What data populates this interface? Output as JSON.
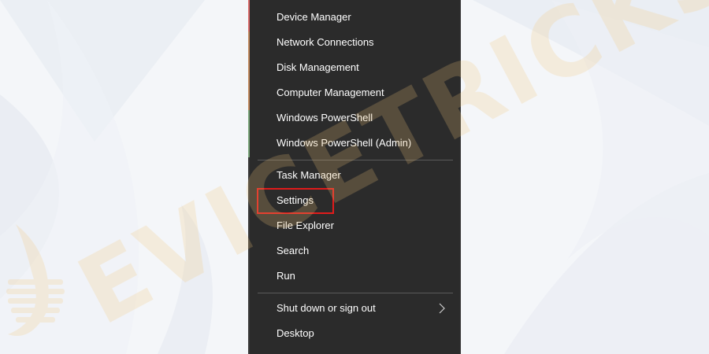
{
  "start_context_menu": {
    "group_1": [
      {
        "id": "device-manager",
        "label": "Device Manager"
      },
      {
        "id": "network-connections",
        "label": "Network Connections"
      },
      {
        "id": "disk-management",
        "label": "Disk Management"
      },
      {
        "id": "computer-management",
        "label": "Computer Management"
      },
      {
        "id": "windows-powershell",
        "label": "Windows PowerShell"
      },
      {
        "id": "windows-powershell-admin",
        "label": "Windows PowerShell (Admin)"
      }
    ],
    "group_2": [
      {
        "id": "task-manager",
        "label": "Task Manager"
      },
      {
        "id": "settings",
        "label": "Settings"
      },
      {
        "id": "file-explorer",
        "label": "File Explorer"
      },
      {
        "id": "search",
        "label": "Search"
      },
      {
        "id": "run",
        "label": "Run"
      }
    ],
    "group_3": [
      {
        "id": "shut-down-or-sign-out",
        "label": "Shut down or sign out",
        "has_submenu": true
      },
      {
        "id": "desktop",
        "label": "Desktop"
      }
    ],
    "highlighted_item": "settings"
  },
  "colors": {
    "menu_background": "#2b2b2b",
    "menu_text": "#ffffff",
    "separator": "#5a5a5a",
    "highlight_border": "#e01b1b",
    "watermark": "#f3c77a",
    "desktop_background": "#f3f5f8"
  },
  "icons": {
    "submenu_arrow": "chevron-right-icon"
  },
  "watermark_logo": {
    "text": "DEVICETRICKS"
  }
}
